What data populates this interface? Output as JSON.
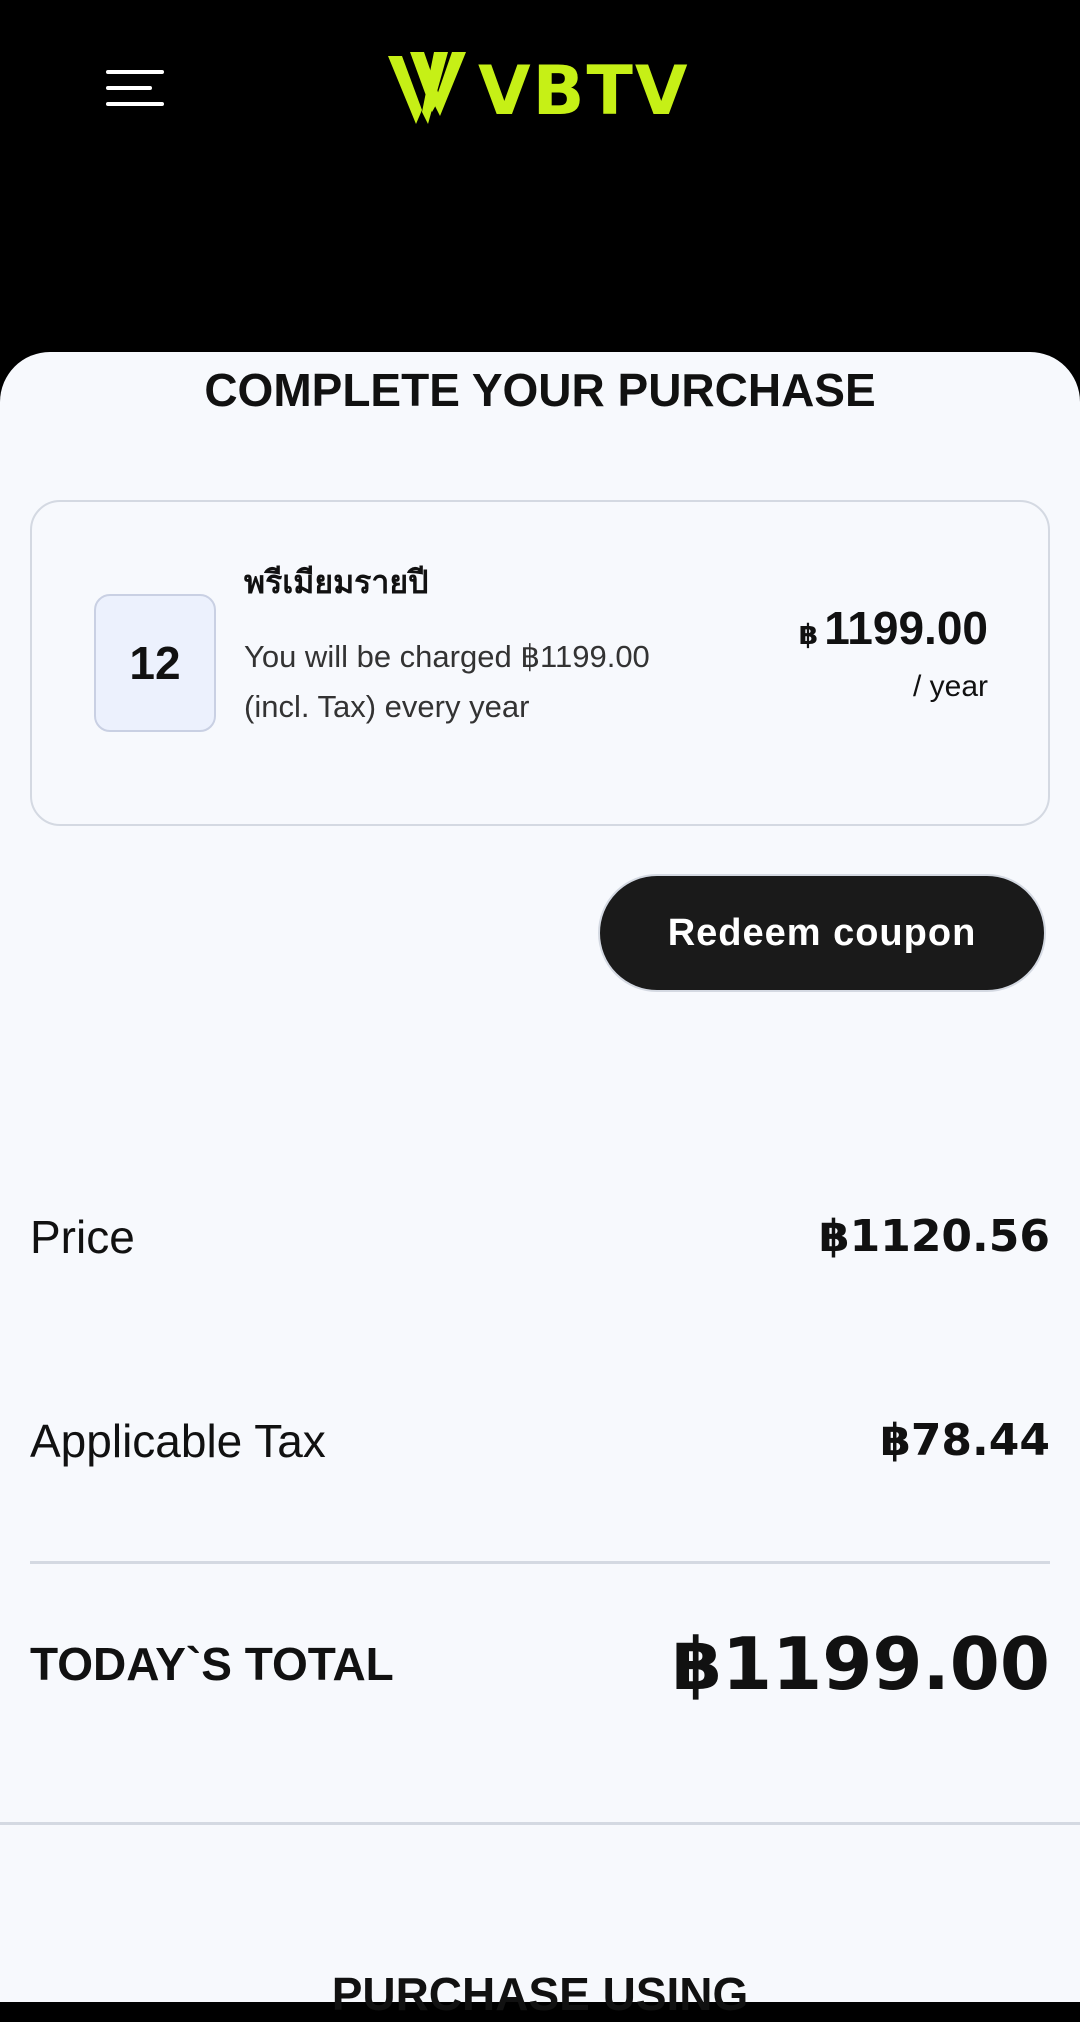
{
  "header": {
    "menu_icon": "hamburger-menu-icon",
    "logo_text": "VBTV",
    "logo_color": "#c6f016"
  },
  "page_title": "COMPLETE YOUR PURCHASE",
  "plan": {
    "months": "12",
    "name": "พรีเมียมรายปี",
    "description": "You will be charged ฿1199.00 (incl. Tax) every year",
    "currency_symbol": "฿",
    "price": "1199.00",
    "period": "/ year"
  },
  "redeem_coupon_label": "Redeem coupon",
  "summary": {
    "price_label": "Price",
    "price_value": "฿1120.56",
    "tax_label": "Applicable Tax",
    "tax_value": "฿78.44",
    "total_label": "TODAY`S TOTAL",
    "total_value": "฿1199.00"
  },
  "purchase_using_label": "PURCHASE USING",
  "colors": {
    "background": "#f7f9fd",
    "header": "#000000",
    "button": "#1a1a1a",
    "accent": "#c6f016"
  }
}
